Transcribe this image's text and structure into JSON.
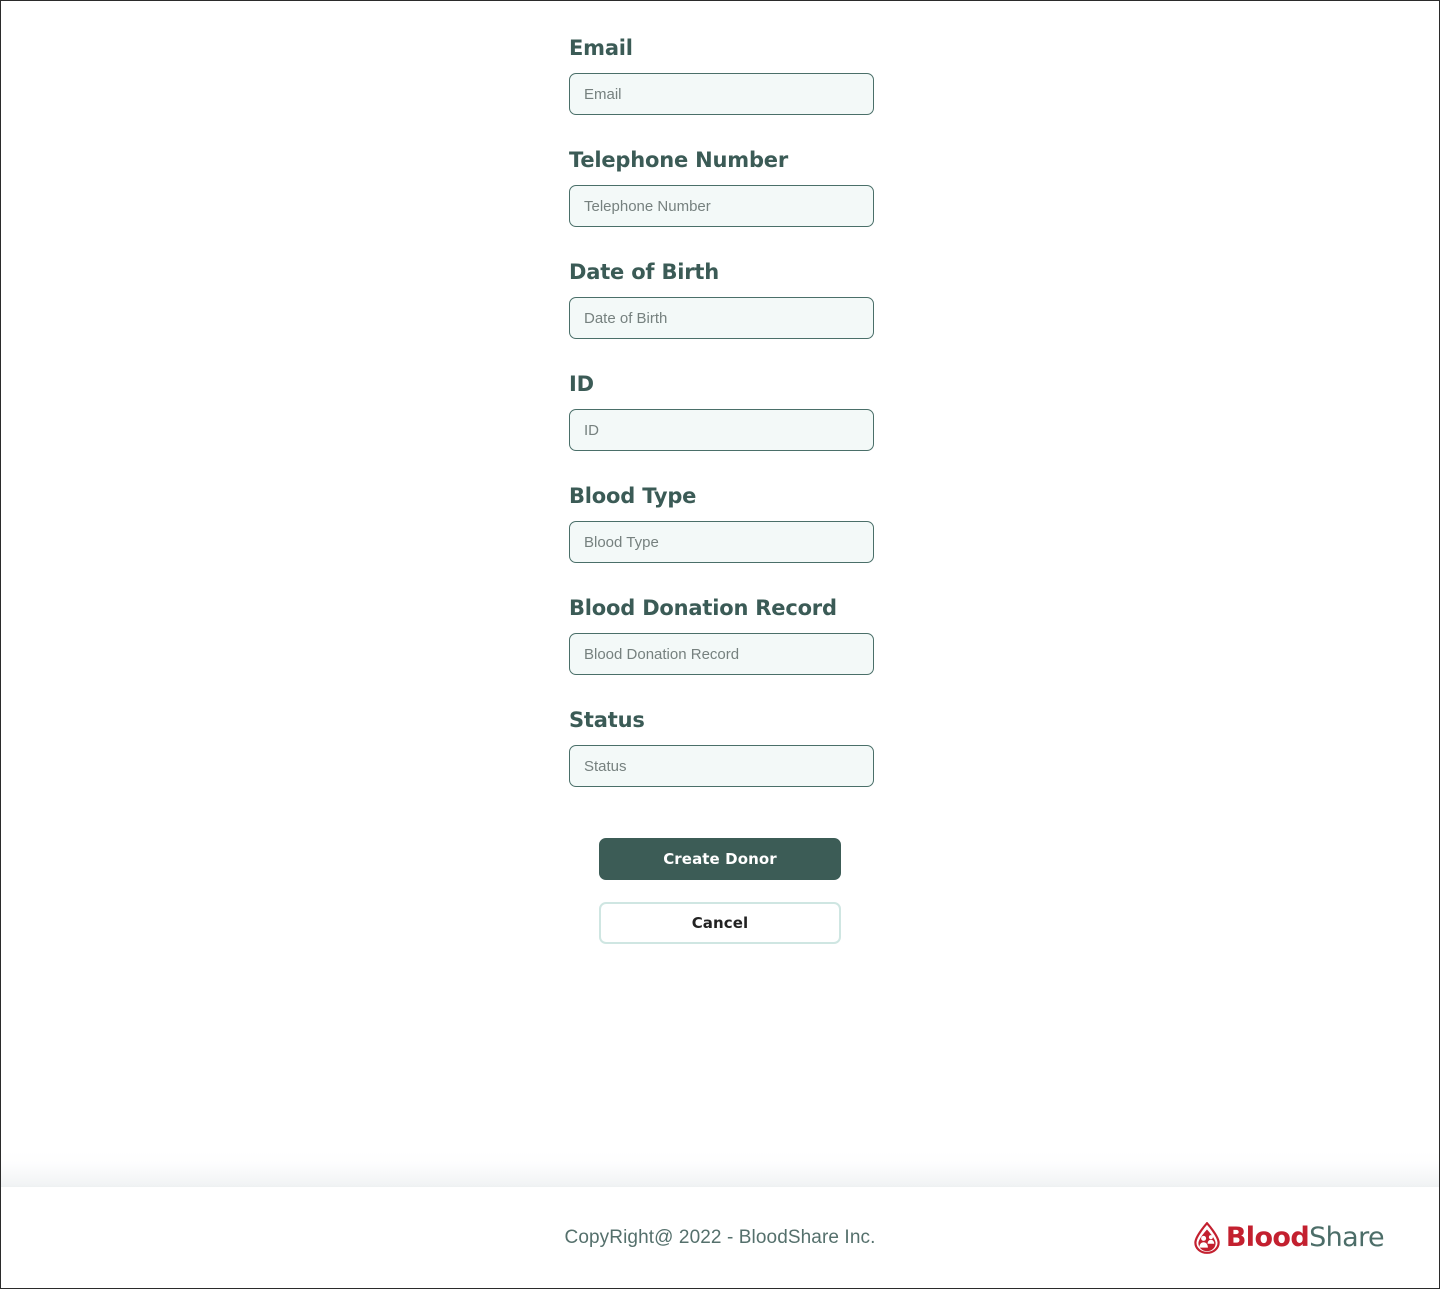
{
  "brand": {
    "name_part1": "Blood",
    "name_part2": "Share",
    "logo_icon": "blood-drop-donors-icon",
    "color_primary": "#c3202f",
    "color_secondary": "#4c6d68"
  },
  "theme": {
    "label_color": "#3b5b56",
    "input_bg": "#f3f9f8",
    "input_border": "#4a6f69",
    "primary_button_bg": "#3c5c56",
    "secondary_button_border": "#cfe6e2",
    "footer_text_color": "#55706c"
  },
  "form": {
    "title": "Create Donor",
    "fields": [
      {
        "label": "Email",
        "placeholder": "Email",
        "value": "",
        "name": "email"
      },
      {
        "label": "Telephone Number",
        "placeholder": "Telephone Number",
        "value": "",
        "name": "telephone-number"
      },
      {
        "label": "Date of Birth",
        "placeholder": "Date of Birth",
        "value": "",
        "name": "date-of-birth"
      },
      {
        "label": "ID",
        "placeholder": "ID",
        "value": "",
        "name": "id"
      },
      {
        "label": "Blood Type",
        "placeholder": "Blood Type",
        "value": "",
        "name": "blood-type"
      },
      {
        "label": "Blood Donation Record",
        "placeholder": "Blood Donation Record",
        "value": "",
        "name": "blood-donation-record"
      },
      {
        "label": "Status",
        "placeholder": "Status",
        "value": "",
        "name": "status"
      }
    ],
    "submit_label": "Create Donor",
    "cancel_label": "Cancel"
  },
  "footer": {
    "copyright": "CopyRight@ 2022 - BloodShare Inc."
  }
}
